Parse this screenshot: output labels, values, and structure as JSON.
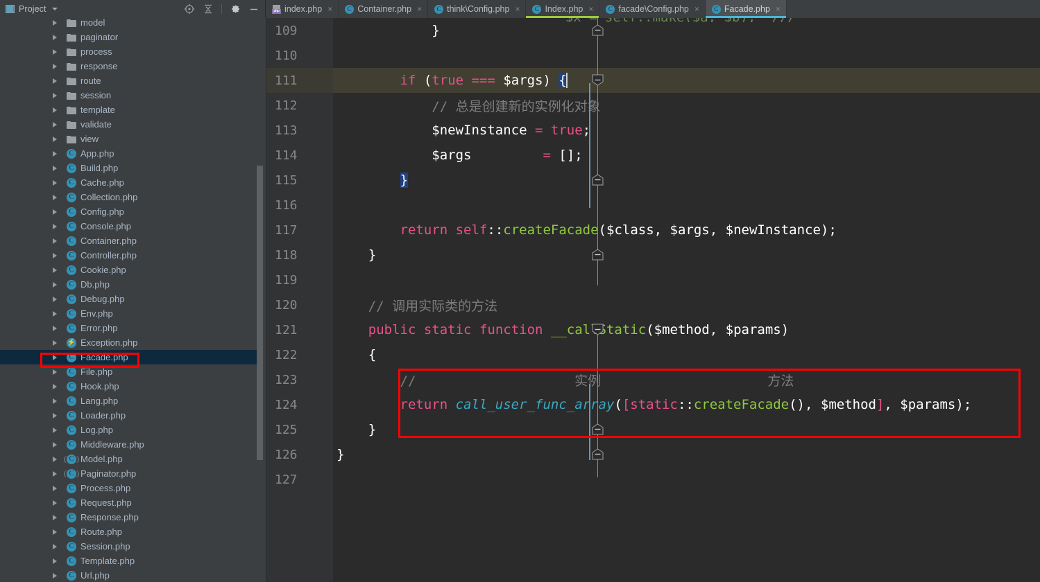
{
  "app": {
    "theme_bg": "#3c3f41",
    "editor_bg": "#2b2b2b",
    "accent": "#3592b5",
    "annotation_color": "#ff0000"
  },
  "project_panel": {
    "title": "Project",
    "window_icon": "project-window-icon",
    "dropdown_icon": "chevron-down-icon",
    "tools": [
      {
        "name": "locate-target-icon",
        "label": "Select Opened File"
      },
      {
        "name": "collapse-all-icon",
        "label": "Collapse All"
      },
      {
        "name": "gear-icon",
        "label": "Settings"
      },
      {
        "name": "minimize-icon",
        "label": "Hide"
      }
    ],
    "tree": [
      {
        "label": "model",
        "icon": "folder",
        "indent": 1,
        "selected": false
      },
      {
        "label": "paginator",
        "icon": "folder",
        "indent": 1,
        "selected": false
      },
      {
        "label": "process",
        "icon": "folder",
        "indent": 1,
        "selected": false
      },
      {
        "label": "response",
        "icon": "folder",
        "indent": 1,
        "selected": false
      },
      {
        "label": "route",
        "icon": "folder",
        "indent": 1,
        "selected": false
      },
      {
        "label": "session",
        "icon": "folder",
        "indent": 1,
        "selected": false
      },
      {
        "label": "template",
        "icon": "folder",
        "indent": 1,
        "selected": false
      },
      {
        "label": "validate",
        "icon": "folder",
        "indent": 1,
        "selected": false
      },
      {
        "label": "view",
        "icon": "folder",
        "indent": 1,
        "selected": false
      },
      {
        "label": "App.php",
        "icon": "class",
        "indent": 1,
        "selected": false
      },
      {
        "label": "Build.php",
        "icon": "class",
        "indent": 1,
        "selected": false
      },
      {
        "label": "Cache.php",
        "icon": "class",
        "indent": 1,
        "selected": false
      },
      {
        "label": "Collection.php",
        "icon": "class",
        "indent": 1,
        "selected": false
      },
      {
        "label": "Config.php",
        "icon": "class",
        "indent": 1,
        "selected": false
      },
      {
        "label": "Console.php",
        "icon": "class",
        "indent": 1,
        "selected": false
      },
      {
        "label": "Container.php",
        "icon": "class",
        "indent": 1,
        "selected": false
      },
      {
        "label": "Controller.php",
        "icon": "class",
        "indent": 1,
        "selected": false
      },
      {
        "label": "Cookie.php",
        "icon": "class",
        "indent": 1,
        "selected": false
      },
      {
        "label": "Db.php",
        "icon": "class",
        "indent": 1,
        "selected": false
      },
      {
        "label": "Debug.php",
        "icon": "class",
        "indent": 1,
        "selected": false
      },
      {
        "label": "Env.php",
        "icon": "class",
        "indent": 1,
        "selected": false
      },
      {
        "label": "Error.php",
        "icon": "class",
        "indent": 1,
        "selected": false
      },
      {
        "label": "Exception.php",
        "icon": "exception",
        "indent": 1,
        "selected": false
      },
      {
        "label": "Facade.php",
        "icon": "class",
        "indent": 1,
        "selected": true
      },
      {
        "label": "File.php",
        "icon": "class",
        "indent": 1,
        "selected": false
      },
      {
        "label": "Hook.php",
        "icon": "class",
        "indent": 1,
        "selected": false
      },
      {
        "label": "Lang.php",
        "icon": "class",
        "indent": 1,
        "selected": false
      },
      {
        "label": "Loader.php",
        "icon": "class",
        "indent": 1,
        "selected": false
      },
      {
        "label": "Log.php",
        "icon": "class",
        "indent": 1,
        "selected": false
      },
      {
        "label": "Middleware.php",
        "icon": "class",
        "indent": 1,
        "selected": false
      },
      {
        "label": "Model.php",
        "icon": "abstract-class",
        "indent": 1,
        "selected": false
      },
      {
        "label": "Paginator.php",
        "icon": "abstract-class",
        "indent": 1,
        "selected": false
      },
      {
        "label": "Process.php",
        "icon": "class",
        "indent": 1,
        "selected": false
      },
      {
        "label": "Request.php",
        "icon": "class",
        "indent": 1,
        "selected": false
      },
      {
        "label": "Response.php",
        "icon": "class",
        "indent": 1,
        "selected": false
      },
      {
        "label": "Route.php",
        "icon": "class",
        "indent": 1,
        "selected": false
      },
      {
        "label": "Session.php",
        "icon": "class",
        "indent": 1,
        "selected": false
      },
      {
        "label": "Template.php",
        "icon": "class",
        "indent": 1,
        "selected": false
      },
      {
        "label": "Url.php",
        "icon": "class",
        "indent": 1,
        "selected": false
      }
    ]
  },
  "tabs": [
    {
      "label": "index.php",
      "icon": "php-file-icon",
      "active": false,
      "modified_marker": ""
    },
    {
      "label": "Container.php",
      "icon": "php-class-icon",
      "active": false,
      "modified_marker": ""
    },
    {
      "label": "think\\Config.php",
      "icon": "php-class-icon",
      "active": false,
      "modified_marker": ""
    },
    {
      "label": "Index.php",
      "icon": "php-class-icon",
      "active": false,
      "modified_marker": "#9fc93c"
    },
    {
      "label": "facade\\Config.php",
      "icon": "php-class-icon",
      "active": false,
      "modified_marker": ""
    },
    {
      "label": "Facade.php",
      "icon": "php-class-icon",
      "active": true,
      "modified_marker": "#4ab6d8"
    }
  ],
  "tab_close_glyph": "×",
  "editor": {
    "first_line": 109,
    "lines": [
      {
        "num": "109",
        "fold": "collapse-end",
        "current": false,
        "tokens": [
          {
            "t": "            ",
            "c": "t-punc"
          },
          {
            "t": "}",
            "c": "t-punc"
          }
        ]
      },
      {
        "num": "110",
        "fold": "none",
        "current": false,
        "tokens": []
      },
      {
        "num": "111",
        "fold": "collapse-start",
        "current": true,
        "changed": true,
        "tokens": [
          {
            "t": "        ",
            "c": "t-punc"
          },
          {
            "t": "if",
            "c": "t-kw"
          },
          {
            "t": " ",
            "c": "t-punc"
          },
          {
            "t": "(",
            "c": "t-punc"
          },
          {
            "t": "true",
            "c": "t-kw"
          },
          {
            "t": " ",
            "c": "t-punc"
          },
          {
            "t": "===",
            "c": "t-kw"
          },
          {
            "t": " ",
            "c": "t-punc"
          },
          {
            "t": "$args",
            "c": "t-var"
          },
          {
            "t": ")",
            "c": "t-punc"
          },
          {
            "t": " ",
            "c": "t-punc"
          },
          {
            "t": "{",
            "c": "sel-brace"
          }
        ]
      },
      {
        "num": "112",
        "fold": "none",
        "current": false,
        "changed": true,
        "tokens": [
          {
            "t": "            ",
            "c": "t-punc"
          },
          {
            "t": "// 总是创建新的实例化对象",
            "c": "t-cmt-cn"
          }
        ]
      },
      {
        "num": "113",
        "fold": "none",
        "current": false,
        "changed": true,
        "tokens": [
          {
            "t": "            ",
            "c": "t-punc"
          },
          {
            "t": "$newInstance",
            "c": "t-var"
          },
          {
            "t": " = ",
            "c": "t-kw"
          },
          {
            "t": "true",
            "c": "t-kw"
          },
          {
            "t": ";",
            "c": "t-punc"
          }
        ]
      },
      {
        "num": "114",
        "fold": "none",
        "current": false,
        "changed": true,
        "tokens": [
          {
            "t": "            ",
            "c": "t-punc"
          },
          {
            "t": "$args",
            "c": "t-var"
          },
          {
            "t": "         ",
            "c": "t-punc"
          },
          {
            "t": "= ",
            "c": "t-kw"
          },
          {
            "t": "[]",
            "c": "t-punc"
          },
          {
            "t": ";",
            "c": "t-punc"
          }
        ]
      },
      {
        "num": "115",
        "fold": "collapse-end",
        "current": false,
        "changed": true,
        "tokens": [
          {
            "t": "        ",
            "c": "t-punc"
          },
          {
            "t": "}",
            "c": "sel-brace"
          }
        ]
      },
      {
        "num": "116",
        "fold": "none",
        "current": false,
        "tokens": []
      },
      {
        "num": "117",
        "fold": "none",
        "current": false,
        "tokens": [
          {
            "t": "        ",
            "c": "t-punc"
          },
          {
            "t": "return",
            "c": "t-kw"
          },
          {
            "t": " ",
            "c": "t-punc"
          },
          {
            "t": "self",
            "c": "t-kw"
          },
          {
            "t": "::",
            "c": "t-punc"
          },
          {
            "t": "createFacade",
            "c": "t-fn"
          },
          {
            "t": "(",
            "c": "t-punc"
          },
          {
            "t": "$class",
            "c": "t-var"
          },
          {
            "t": ", ",
            "c": "t-punc"
          },
          {
            "t": "$args",
            "c": "t-var"
          },
          {
            "t": ", ",
            "c": "t-punc"
          },
          {
            "t": "$newInstance",
            "c": "t-var"
          },
          {
            "t": ");",
            "c": "t-punc"
          }
        ]
      },
      {
        "num": "118",
        "fold": "collapse-end",
        "current": false,
        "tokens": [
          {
            "t": "    ",
            "c": "t-punc"
          },
          {
            "t": "}",
            "c": "t-punc"
          }
        ]
      },
      {
        "num": "119",
        "fold": "none",
        "current": false,
        "tokens": []
      },
      {
        "num": "120",
        "fold": "none",
        "current": false,
        "tokens": [
          {
            "t": "    ",
            "c": "t-punc"
          },
          {
            "t": "// 调用实际类的方法",
            "c": "t-cmt-cn"
          }
        ]
      },
      {
        "num": "121",
        "fold": "collapse-start",
        "current": false,
        "tokens": [
          {
            "t": "    ",
            "c": "t-punc"
          },
          {
            "t": "public",
            "c": "t-kw"
          },
          {
            "t": " ",
            "c": "t-punc"
          },
          {
            "t": "static",
            "c": "t-kw"
          },
          {
            "t": " ",
            "c": "t-punc"
          },
          {
            "t": "function",
            "c": "t-kw"
          },
          {
            "t": " ",
            "c": "t-punc"
          },
          {
            "t": "__callStatic",
            "c": "t-fn"
          },
          {
            "t": "(",
            "c": "t-punc"
          },
          {
            "t": "$method",
            "c": "t-var"
          },
          {
            "t": ", ",
            "c": "t-punc"
          },
          {
            "t": "$params",
            "c": "t-var"
          },
          {
            "t": ")",
            "c": "t-punc"
          }
        ]
      },
      {
        "num": "122",
        "fold": "none",
        "current": false,
        "tokens": [
          {
            "t": "    ",
            "c": "t-punc"
          },
          {
            "t": "{",
            "c": "t-punc"
          }
        ]
      },
      {
        "num": "123",
        "fold": "none",
        "current": false,
        "tokens": [
          {
            "t": "        ",
            "c": "t-punc"
          },
          {
            "t": "//                    实例                     方法",
            "c": "t-cmt-cn"
          }
        ]
      },
      {
        "num": "124",
        "fold": "none",
        "current": false,
        "tokens": [
          {
            "t": "        ",
            "c": "t-punc"
          },
          {
            "t": "return",
            "c": "t-kw"
          },
          {
            "t": " ",
            "c": "t-punc"
          },
          {
            "t": "call_user_func_array",
            "c": "t-func-it"
          },
          {
            "t": "(",
            "c": "t-punc"
          },
          {
            "t": "[",
            "c": "t-bracket"
          },
          {
            "t": "static",
            "c": "t-kw"
          },
          {
            "t": "::",
            "c": "t-punc"
          },
          {
            "t": "createFacade",
            "c": "t-fn"
          },
          {
            "t": "(), ",
            "c": "t-punc"
          },
          {
            "t": "$method",
            "c": "t-var"
          },
          {
            "t": "]",
            "c": "t-bracket"
          },
          {
            "t": ", ",
            "c": "t-punc"
          },
          {
            "t": "$params",
            "c": "t-var"
          },
          {
            "t": ");",
            "c": "t-punc"
          }
        ]
      },
      {
        "num": "125",
        "fold": "collapse-end",
        "current": false,
        "tokens": [
          {
            "t": "    ",
            "c": "t-punc"
          },
          {
            "t": "}",
            "c": "t-punc"
          }
        ]
      },
      {
        "num": "126",
        "fold": "collapse-end",
        "current": false,
        "tokens": [
          {
            "t": "}",
            "c": "t-punc"
          }
        ]
      },
      {
        "num": "127",
        "fold": "none",
        "current": false,
        "tokens": []
      }
    ]
  },
  "annotations": [
    {
      "name": "facade-file-highlight-box",
      "target": "Facade.php sidebar entry"
    },
    {
      "name": "callstatic-code-highlight-box",
      "target": "lines 123-124 return call_user_func_array"
    }
  ]
}
